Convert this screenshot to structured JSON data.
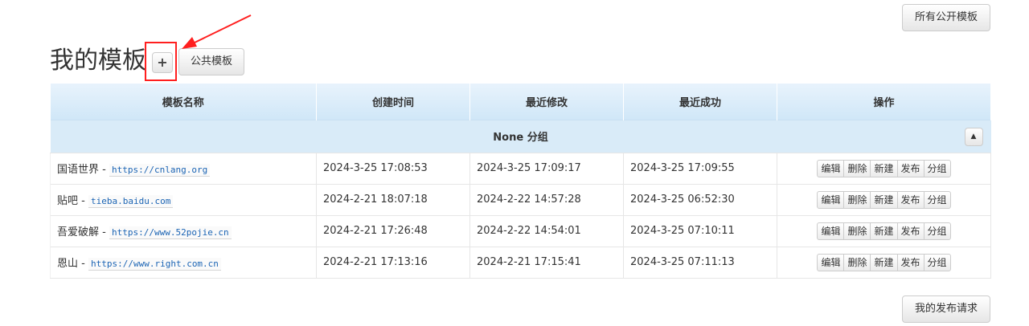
{
  "top_right_button": "所有公开模板",
  "bottom_right_button": "我的发布请求",
  "header": {
    "title": "我的模板",
    "add_label": "+",
    "public_button": "公共模板"
  },
  "table": {
    "columns": [
      "模板名称",
      "创建时间",
      "最近修改",
      "最近成功",
      "操作"
    ],
    "group_label": "None 分组",
    "collapse_icon": "▲",
    "rows": [
      {
        "name": "国语世界",
        "sep": " - ",
        "url": "https://cnlang.org",
        "created": "2024-3-25 17:08:53",
        "modified": "2024-3-25 17:09:17",
        "success": "2024-3-25 17:09:55"
      },
      {
        "name": "贴吧",
        "sep": " - ",
        "url": "tieba.baidu.com",
        "created": "2024-2-21 18:07:18",
        "modified": "2024-2-22 14:57:28",
        "success": "2024-3-25 06:52:30"
      },
      {
        "name": "吾爱破解",
        "sep": " - ",
        "url": "https://www.52pojie.cn",
        "created": "2024-2-21 17:26:48",
        "modified": "2024-2-22 14:54:01",
        "success": "2024-3-25 07:10:11"
      },
      {
        "name": "恩山",
        "sep": " - ",
        "url": "https://www.right.com.cn",
        "created": "2024-2-21 17:13:16",
        "modified": "2024-2-21 17:15:41",
        "success": "2024-3-25 07:11:13"
      }
    ],
    "actions": [
      "编辑",
      "删除",
      "新建",
      "发布",
      "分组"
    ]
  },
  "colors": {
    "annotation_red": "#ff1f1f",
    "header_bg": "#d0e7f8",
    "group_bg": "#d9ebf8",
    "link": "#1b64b4"
  }
}
